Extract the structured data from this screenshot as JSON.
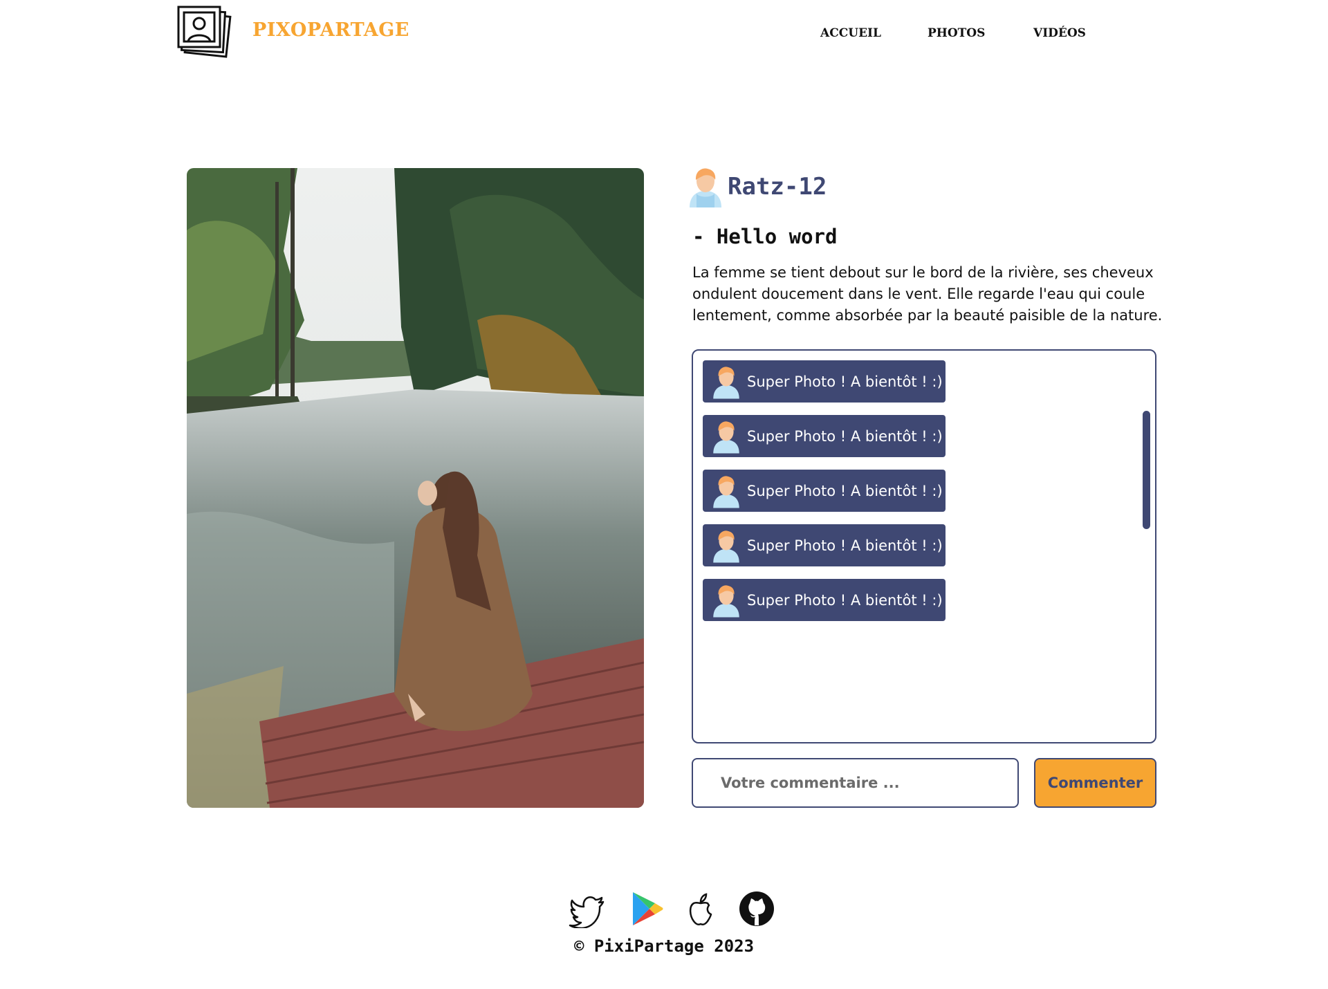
{
  "header": {
    "brand": "PIXOPARTAGE",
    "logo_icon": "stacked-photos-icon",
    "nav": [
      "ACCUEIL",
      "PHOTOS",
      "VIDÉOS"
    ]
  },
  "post": {
    "author": "Ratz-12",
    "title": "- Hello word",
    "description": "La femme se tient debout sur le bord de la rivière, ses cheveux ondulent doucement dans le vent. Elle regarde l'eau qui coule lentement, comme absorbée par la beauté paisible de la nature."
  },
  "comments": [
    {
      "text": "Super Photo ! A bientôt ! :)"
    },
    {
      "text": "Super Photo ! A bientôt ! :)"
    },
    {
      "text": "Super Photo ! A bientôt ! :)"
    },
    {
      "text": "Super Photo ! A bientôt ! :)"
    },
    {
      "text": "Super Photo ! A bientôt ! :)"
    }
  ],
  "form": {
    "placeholder": "Votre commentaire ...",
    "button": "Commenter"
  },
  "footer": {
    "icons": [
      "twitter-icon",
      "google-play-icon",
      "apple-icon",
      "github-icon"
    ],
    "copyright": "© PixiPartage 2023"
  },
  "colors": {
    "accent": "#F7A531",
    "primary": "#3F4873"
  }
}
